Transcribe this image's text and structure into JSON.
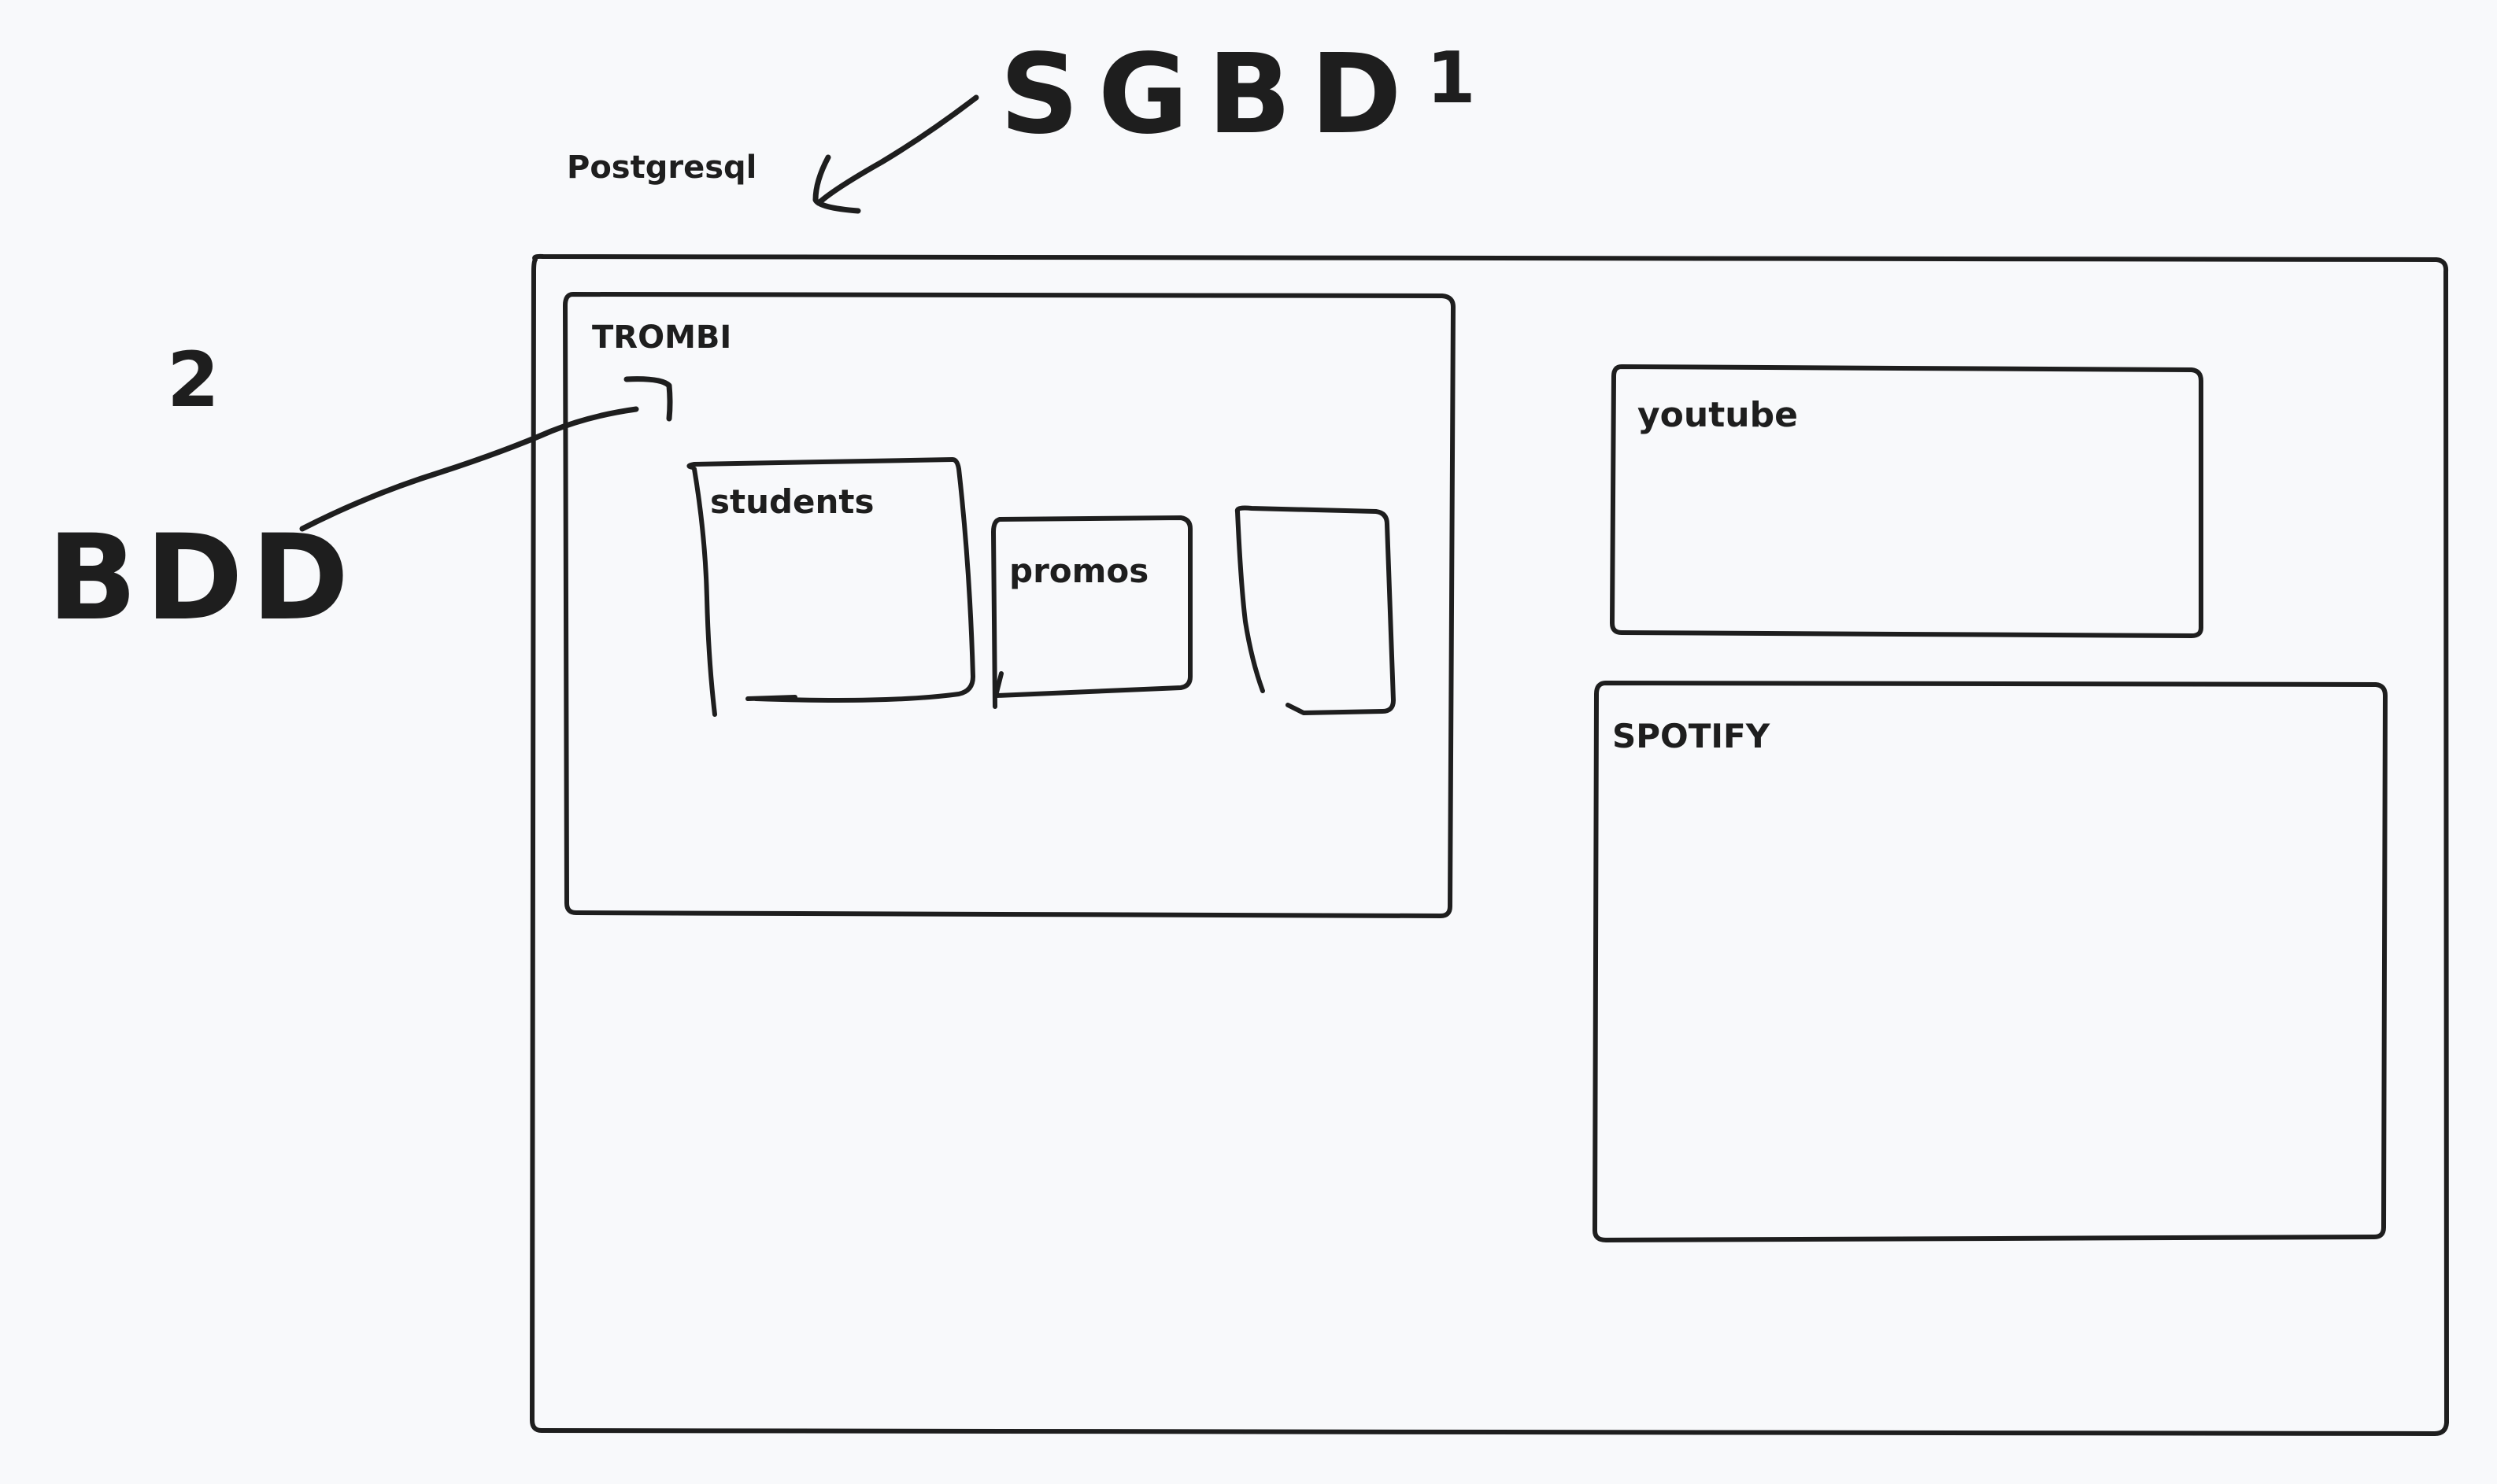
{
  "annotations": {
    "sgbd": "SGBD",
    "postgresql": "Postgresql",
    "number_one": "1",
    "number_two": "2",
    "bdd": "BDD"
  },
  "boxes": {
    "trombi": "TROMBI",
    "students": "students",
    "promos": "promos",
    "youtube": "youtube",
    "spotify": "SPOTIFY"
  }
}
